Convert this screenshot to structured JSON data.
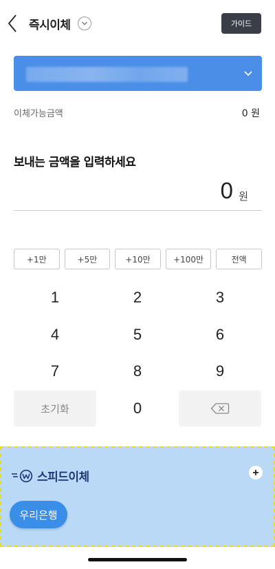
{
  "header": {
    "title": "즉시이체",
    "guide_label": "가이드",
    "back_icon": "chevron-left-icon",
    "title_dropdown_icon": "chevron-down-circle-icon"
  },
  "account": {
    "selected": "",
    "dropdown_icon": "chevron-down-icon",
    "color": "#4a8ee8"
  },
  "balance": {
    "label": "이체가능금액",
    "value": "0 원"
  },
  "amount": {
    "prompt": "보내는 금액을 입력하세요",
    "value": "0",
    "unit": "원"
  },
  "quick_amounts": [
    "+1만",
    "+5만",
    "+10만",
    "+100만",
    "전액"
  ],
  "keypad": {
    "keys": [
      "1",
      "2",
      "3",
      "4",
      "5",
      "6",
      "7",
      "8",
      "9"
    ],
    "reset_label": "초기화",
    "zero": "0",
    "backspace_icon": "backspace-icon"
  },
  "speed_transfer": {
    "title": "스피드이체",
    "logo_icon": "speed-w-icon",
    "add_icon": "plus-icon",
    "banks": [
      "우리은행"
    ],
    "bg_color": "#b9d9f7",
    "chip_color": "#3a8ee8"
  }
}
